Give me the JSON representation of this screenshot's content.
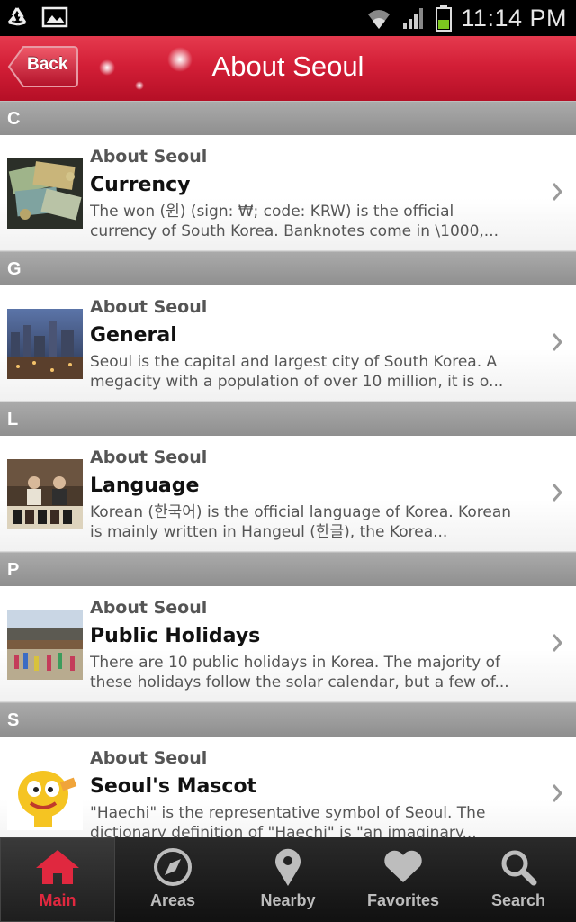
{
  "status_bar": {
    "time": "11:14 PM",
    "icons": [
      "recycle-icon",
      "image-icon",
      "wifi-icon",
      "signal-icon",
      "battery-icon"
    ]
  },
  "header": {
    "back_label": "Back",
    "title": "About Seoul"
  },
  "sections": [
    {
      "letter": "C",
      "items": [
        {
          "category": "About Seoul",
          "title": "Currency",
          "description": "The won (원) (sign: ₩; code: KRW) is the official currency of South Korea. Banknotes come in \\1000,..."
        }
      ]
    },
    {
      "letter": "G",
      "items": [
        {
          "category": "About Seoul",
          "title": "General",
          "description": "Seoul is the capital and largest city of South Korea. A megacity with a population of over 10 million, it is o..."
        }
      ]
    },
    {
      "letter": "L",
      "items": [
        {
          "category": "About Seoul",
          "title": "Language",
          "description": "Korean (한국어) is the official language of Korea. Korean is mainly written in Hangeul (한글), the Korea..."
        }
      ]
    },
    {
      "letter": "P",
      "items": [
        {
          "category": "About Seoul",
          "title": "Public Holidays",
          "description": "There are 10 public holidays in Korea. The majority of these holidays follow the solar calendar, but a few of..."
        }
      ]
    },
    {
      "letter": "S",
      "items": [
        {
          "category": "About Seoul",
          "title": "Seoul's Mascot",
          "description": "\"Haechi\" is the representative symbol of Seoul. The dictionary definition of \"Haechi\" is \"an imaginary..."
        }
      ]
    }
  ],
  "tabs": [
    {
      "label": "Main",
      "icon": "home-icon",
      "active": true
    },
    {
      "label": "Areas",
      "icon": "compass-icon",
      "active": false
    },
    {
      "label": "Nearby",
      "icon": "map-pin-icon",
      "active": false
    },
    {
      "label": "Favorites",
      "icon": "heart-icon",
      "active": false
    },
    {
      "label": "Search",
      "icon": "search-icon",
      "active": false
    }
  ],
  "colors": {
    "accent_red": "#d31f37",
    "active_tab_red": "#e0283f",
    "section_grey": "#9a9a9a"
  }
}
